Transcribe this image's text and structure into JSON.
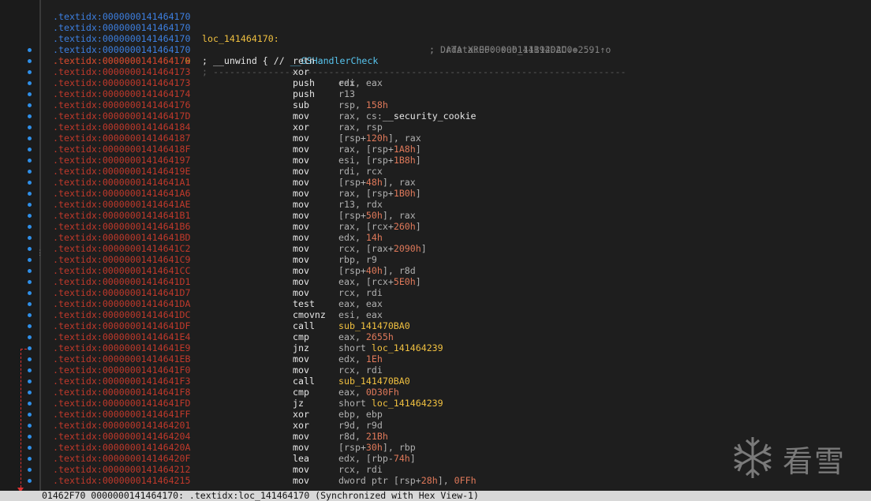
{
  "header_lines": [
    {
      "addr": ".textidx:0000000141464170",
      "label": "",
      "comment": ""
    },
    {
      "addr": ".textidx:0000000141464170",
      "label": "loc_141464170:",
      "comment": "; DATA XREF: sub_1411202D0+2591↑o"
    },
    {
      "addr": ".textidx:0000000141464170",
      "label": "",
      "comment": "; .rdata:0000000141B94DAC↓o ..."
    },
    {
      "addr": ".textidx:0000000141464170",
      "unwind_prefix": "; __unwind { // ",
      "unwind_handler": "__GSHandlerCheck"
    }
  ],
  "current_line": {
    "addr": ".textidx:0000000141464170",
    "mnem": "xor",
    "ops": "eax, eax"
  },
  "instructions": [
    {
      "addr": ".textidx:0000000141464172",
      "mnem": "retn",
      "ops": ""
    },
    {
      "addr": ".textidx:0000000141464173",
      "separator": "; ---------------------------------------------------------------------------"
    },
    {
      "addr": ".textidx:0000000141464173",
      "mnem": "push",
      "ops": "rdi"
    },
    {
      "addr": ".textidx:0000000141464174",
      "mnem": "push",
      "ops": "r13"
    },
    {
      "addr": ".textidx:0000000141464176",
      "mnem": "sub",
      "ops": "rsp, 158h"
    },
    {
      "addr": ".textidx:000000014146417D",
      "mnem": "mov",
      "ops": "rax, cs:__security_cookie"
    },
    {
      "addr": ".textidx:0000000141464184",
      "mnem": "xor",
      "ops": "rax, rsp"
    },
    {
      "addr": ".textidx:0000000141464187",
      "mnem": "mov",
      "ops": "[rsp+120h], rax"
    },
    {
      "addr": ".textidx:000000014146418F",
      "mnem": "mov",
      "ops": "rax, [rsp+1A8h]"
    },
    {
      "addr": ".textidx:0000000141464197",
      "mnem": "mov",
      "ops": "esi, [rsp+1B8h]"
    },
    {
      "addr": ".textidx:000000014146419E",
      "mnem": "mov",
      "ops": "rdi, rcx"
    },
    {
      "addr": ".textidx:00000001414641A1",
      "mnem": "mov",
      "ops": "[rsp+48h], rax"
    },
    {
      "addr": ".textidx:00000001414641A6",
      "mnem": "mov",
      "ops": "rax, [rsp+1B0h]"
    },
    {
      "addr": ".textidx:00000001414641AE",
      "mnem": "mov",
      "ops": "r13, rdx"
    },
    {
      "addr": ".textidx:00000001414641B1",
      "mnem": "mov",
      "ops": "[rsp+50h], rax"
    },
    {
      "addr": ".textidx:00000001414641B6",
      "mnem": "mov",
      "ops": "rax, [rcx+260h]"
    },
    {
      "addr": ".textidx:00000001414641BD",
      "mnem": "mov",
      "ops": "edx, 14h"
    },
    {
      "addr": ".textidx:00000001414641C2",
      "mnem": "mov",
      "ops": "rcx, [rax+2090h]"
    },
    {
      "addr": ".textidx:00000001414641C9",
      "mnem": "mov",
      "ops": "rbp, r9"
    },
    {
      "addr": ".textidx:00000001414641CC",
      "mnem": "mov",
      "ops": "[rsp+40h], r8d"
    },
    {
      "addr": ".textidx:00000001414641D1",
      "mnem": "mov",
      "ops": "eax, [rcx+5E0h]"
    },
    {
      "addr": ".textidx:00000001414641D7",
      "mnem": "mov",
      "ops": "rcx, rdi"
    },
    {
      "addr": ".textidx:00000001414641DA",
      "mnem": "test",
      "ops": "eax, eax"
    },
    {
      "addr": ".textidx:00000001414641DC",
      "mnem": "cmovnz",
      "ops": "esi, eax"
    },
    {
      "addr": ".textidx:00000001414641DF",
      "mnem": "call",
      "ops": "sub_141470BA0"
    },
    {
      "addr": ".textidx:00000001414641E4",
      "mnem": "cmp",
      "ops": "eax, 2655h"
    },
    {
      "addr": ".textidx:00000001414641E9",
      "mnem": "jnz",
      "ops": "short loc_141464239"
    },
    {
      "addr": ".textidx:00000001414641EB",
      "mnem": "mov",
      "ops": "edx, 1Eh"
    },
    {
      "addr": ".textidx:00000001414641F0",
      "mnem": "mov",
      "ops": "rcx, rdi"
    },
    {
      "addr": ".textidx:00000001414641F3",
      "mnem": "call",
      "ops": "sub_141470BA0"
    },
    {
      "addr": ".textidx:00000001414641F8",
      "mnem": "cmp",
      "ops": "eax, 0D30Fh"
    },
    {
      "addr": ".textidx:00000001414641FD",
      "mnem": "jz",
      "ops": "short loc_141464239"
    },
    {
      "addr": ".textidx:00000001414641FF",
      "mnem": "xor",
      "ops": "ebp, ebp"
    },
    {
      "addr": ".textidx:0000000141464201",
      "mnem": "xor",
      "ops": "r9d, r9d"
    },
    {
      "addr": ".textidx:0000000141464204",
      "mnem": "mov",
      "ops": "r8d, 21Bh"
    },
    {
      "addr": ".textidx:000000014146420A",
      "mnem": "mov",
      "ops": "[rsp+30h], rbp"
    },
    {
      "addr": ".textidx:000000014146420F",
      "mnem": "lea",
      "ops": "edx, [rbp-74h]"
    },
    {
      "addr": ".textidx:0000000141464212",
      "mnem": "mov",
      "ops": "rcx, rdi"
    },
    {
      "addr": ".textidx:0000000141464215",
      "mnem": "mov",
      "ops": "dword ptr [rsp+28h], 0FFh"
    }
  ],
  "status_bar": "01462F70 0000000141464170: .textidx:loc_141464170 (Synchronized with Hex View-1)",
  "watermark": {
    "icon": "snowflake-icon",
    "text": "看雪"
  },
  "colors": {
    "address_normal": "#3d7fe0",
    "address_current": "#f0a030",
    "address_obfuscated": "#c0392b",
    "label": "#f0c040",
    "immediate": "#e0795a"
  }
}
